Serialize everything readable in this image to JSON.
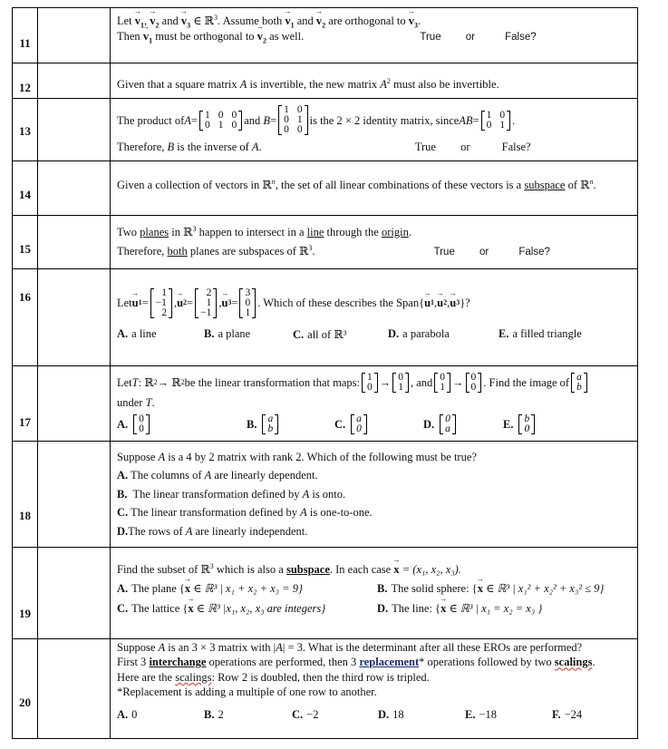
{
  "questions": {
    "q11": {
      "number": "11",
      "l1_a": "Let ",
      "v1": "v",
      "v1s": "1",
      "c1": ", ",
      "v2": "v",
      "v2s": "2",
      "and": " and ",
      "v3": "v",
      "v3s": "3",
      "inR": " ∈ ℝ",
      "inRsup": "3",
      "l1_b": ". Assume both ",
      "l1_c": " and ",
      "l1_d": " are orthogonal to ",
      "end": ".",
      "l2_a": "Then ",
      "l2_b": " must be orthogonal to ",
      "l2_c": " as well.",
      "true_label": "True",
      "or_label": "or",
      "false_label": "False?"
    },
    "q12": {
      "number": "12",
      "a": "Given that a square matrix ",
      "A": "A",
      "b": " is invertible, the new matrix  ",
      "A2": "A",
      "A2sup": "2",
      "c": " must also be invertible."
    },
    "q13": {
      "number": "13",
      "a": "The product of ",
      "A": "A",
      "eq": " = ",
      "matA": [
        [
          "1",
          "0"
        ],
        [
          "0",
          "1"
        ],
        [
          "0",
          "0"
        ]
      ],
      "b": " and ",
      "B": "B",
      "matB": [
        [
          "1",
          "0",
          "0"
        ],
        [
          "0",
          "1",
          "0"
        ]
      ],
      "c": " is the 2 × 2 identity matrix, since ",
      "AB": "AB",
      "matI": [
        [
          "1",
          "0"
        ],
        [
          "0",
          "1"
        ]
      ],
      "period": ".",
      "l2_a": "Therefore, ",
      "l2_B": "B",
      "l2_b": " is the inverse of ",
      "l2_A": "A",
      "l2_c": ".",
      "true_label": "True",
      "or_label": "or",
      "false_label": "False?"
    },
    "q14": {
      "number": "14",
      "a": "Given a collection of vectors in ℝ",
      "asup": "n",
      "b": ", the set of all linear combinations of these vectors is a ",
      "subspace": "subspace",
      "c": " of ℝ",
      "csup": "n",
      "d": "."
    },
    "q15": {
      "number": "15",
      "a": "Two ",
      "planes": "planes",
      "b": " in ℝ",
      "bsup": "3",
      "c": " happen to intersect in a ",
      "line": "line",
      "d": " through the ",
      "origin": "origin",
      "e": ".",
      "l2_a": "Therefore, ",
      "both": "both",
      "l2_b": " planes are subspaces of ℝ",
      "l2_sup": "3",
      "l2_c": ".",
      "true_label": "True",
      "or_label": "or",
      "false_label": "False?"
    },
    "q16": {
      "number": "16",
      "let": "Let ",
      "u": "u",
      "eq": " = ",
      "sep": ",  ",
      "u1": [
        "1",
        "−1",
        "2"
      ],
      "u2": [
        "2",
        "1",
        "−1"
      ],
      "u3": [
        "3",
        "0",
        "1"
      ],
      "b": ".  Which of these describes the Span{ ",
      "c": ", ",
      "d": "}?",
      "options": [
        {
          "label": "A.",
          "text": "a line"
        },
        {
          "label": "B.",
          "text": "a plane"
        },
        {
          "label": "C.",
          "text": "all of ℝ³"
        },
        {
          "label": "D.",
          "text": "a parabola"
        },
        {
          "label": "E.",
          "text": "a filled triangle"
        }
      ]
    },
    "q17": {
      "number": "17",
      "a": "Let ",
      "T": "T",
      "b": ": ℝ",
      "bsup": "2",
      "arrow": " → ℝ",
      "arrowsup": "2",
      "c": " be the linear transformation that maps:  ",
      "m1": [
        "1",
        "0"
      ],
      "to": " → ",
      "m2": [
        "0",
        "1"
      ],
      "and": ", and ",
      "m3": [
        "0",
        "1"
      ],
      "to2": "→",
      "m4": [
        "0",
        "0"
      ],
      "d": ". Find the image of ",
      "m5": [
        "a",
        "b"
      ],
      "l2_a": "under ",
      "l2_T": "T",
      "l2_b": ".",
      "options": [
        {
          "label": "A.",
          "vec": [
            "0",
            "0"
          ],
          "italic": false
        },
        {
          "label": "B.",
          "vec": [
            "a",
            "b"
          ],
          "italic": true
        },
        {
          "label": "C.",
          "vec": [
            "a",
            "0"
          ],
          "italic": true
        },
        {
          "label": "D.",
          "vec": [
            "0",
            "a"
          ],
          "italic": true
        },
        {
          "label": "E.",
          "vec": [
            "b",
            "0"
          ],
          "italic": true
        }
      ]
    },
    "q18": {
      "number": "18",
      "a": "Suppose ",
      "A": "A",
      "b": " is a 4 by 2 matrix with rank 2.  Which of the following must be true?",
      "options": [
        {
          "label": "A.",
          "pre": " The columns of ",
          "post": " are linearly dependent."
        },
        {
          "label": "B.",
          "pre": "  The linear transformation defined by ",
          "post": " is onto."
        },
        {
          "label": "C.",
          "pre": " The linear transformation defined by ",
          "post": " is one-to-one."
        },
        {
          "label": "D.",
          "pre": "The rows of ",
          "post": " are linearly independent."
        }
      ]
    },
    "q19": {
      "number": "19",
      "a": "Find the subset of ℝ",
      "asup": "3",
      "b": " which is also a ",
      "subspace": "subspace",
      "c": ". In each case ",
      "x": "x",
      "d": " = (x₁,  x₂,  x₃).",
      "optA": {
        "label": "A.",
        "text": "The plane {",
        "rest": " ∈ ℝ³ | x₁ + x₂ + x₃ =  9}"
      },
      "optB": {
        "label": "B.",
        "text": "The solid sphere: {",
        "rest": " ∈ ℝ³ | x₁² + x₂² + x₃² ≤  9}"
      },
      "optC": {
        "label": "C.",
        "text": "The lattice {",
        "rest": " ∈ ℝ³ |x₁, x₂, x₃ are integers}"
      },
      "optD": {
        "label": "D.",
        "text": "The line: {",
        "rest": " ∈ ℝ³ | x₁ = x₂ = x₃ }"
      }
    },
    "q20": {
      "number": "20",
      "l1_a": "Suppose ",
      "A": "A",
      "l1_b": " is an 3 × 3 matrix with |",
      "l1_c": "| = 3.   What is the determinant after all these EROs are performed?",
      "l2_a": "First 3 ",
      "interchange": "interchange",
      "l2_b": " operations are performed, then 3 ",
      "replacement": "replacement",
      "l2_c": "* operations followed by two ",
      "scalings": "scalings",
      "l2_d": ".",
      "l3_a": "Here are the ",
      "l3_scalings": "scalings",
      "l3_b": ":  Row 2 is doubled, then the third row is tripled.",
      "l4": "*Replacement is adding a multiple of one row to another.",
      "options": [
        {
          "label": "A.",
          "text": "0"
        },
        {
          "label": "B.",
          "text": "2"
        },
        {
          "label": "C.",
          "text": "−2"
        },
        {
          "label": "D.",
          "text": "18"
        },
        {
          "label": "E.",
          "text": "−18"
        },
        {
          "label": "F.",
          "text": "−24"
        }
      ]
    }
  }
}
